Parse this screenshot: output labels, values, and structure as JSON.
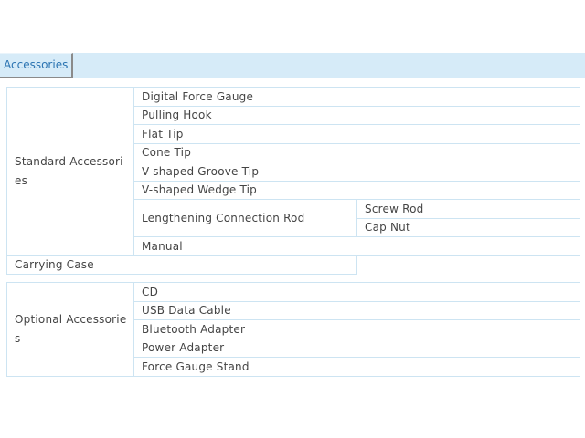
{
  "tab": {
    "label": "Accessories"
  },
  "standard": {
    "label": "Standard Accessories",
    "items": [
      "Digital Force Gauge",
      "Pulling Hook",
      "Flat Tip",
      "Cone Tip",
      "V-shaped Groove Tip",
      "V-shaped Wedge Tip"
    ],
    "rod": {
      "label": "Lengthening Connection Rod",
      "parts": [
        "Screw Rod",
        "Cap Nut"
      ]
    },
    "items_after": [
      "Manual",
      "Carrying Case"
    ]
  },
  "optional": {
    "label": "Optional Accessories",
    "items": [
      "CD",
      "USB Data Cable",
      "Bluetooth Adapter",
      "Power Adapter",
      "Force Gauge Stand"
    ]
  },
  "colors": {
    "tab_background": "#d6ebf8",
    "tab_text": "#2a73b1",
    "table_border": "#cde4f2",
    "cell_text": "#444444"
  }
}
